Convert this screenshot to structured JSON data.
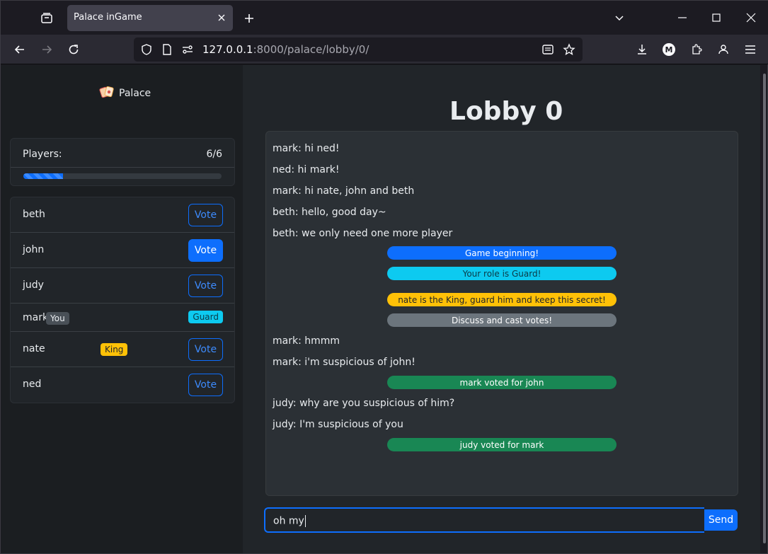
{
  "browser": {
    "tab_title": "Palace inGame",
    "url_host": "127.0.0.1",
    "url_rest": ":8000/palace/lobby/0/"
  },
  "sidebar": {
    "brand": "Palace",
    "players_label": "Players:",
    "players_count": "6/6",
    "players_fraction": 0.2,
    "players": [
      {
        "name": "beth",
        "action": "Vote"
      },
      {
        "name": "john",
        "action": "Vote"
      },
      {
        "name": "judy",
        "action": "Vote"
      },
      {
        "name": "mark",
        "badge": "You",
        "role": "Guard"
      },
      {
        "name": "nate",
        "badge": "King",
        "action": "Vote"
      },
      {
        "name": "ned",
        "action": "Vote"
      }
    ]
  },
  "main": {
    "title": "Lobby 0",
    "messages": [
      "mark: hi ned!",
      "ned: hi mark!",
      "mark: hi nate, john and beth",
      "beth: hello, good day~",
      "beth: we only need one more player",
      "Game beginning!",
      "Your role is Guard!",
      "nate is the King, guard him and keep this secret!",
      "Discuss and cast votes!",
      "mark: hmmm",
      "mark: i'm suspicious of john!",
      "mark voted for john",
      "judy: why are you suspicious of him?",
      "judy: I'm suspicious of you",
      "judy voted for mark"
    ],
    "input_value": "oh my",
    "send_label": "Send"
  },
  "colors": {
    "primary": "#0d6efd",
    "info": "#0dcaf0",
    "warning": "#ffc107",
    "secondary": "#6c757d",
    "success": "#198754"
  }
}
